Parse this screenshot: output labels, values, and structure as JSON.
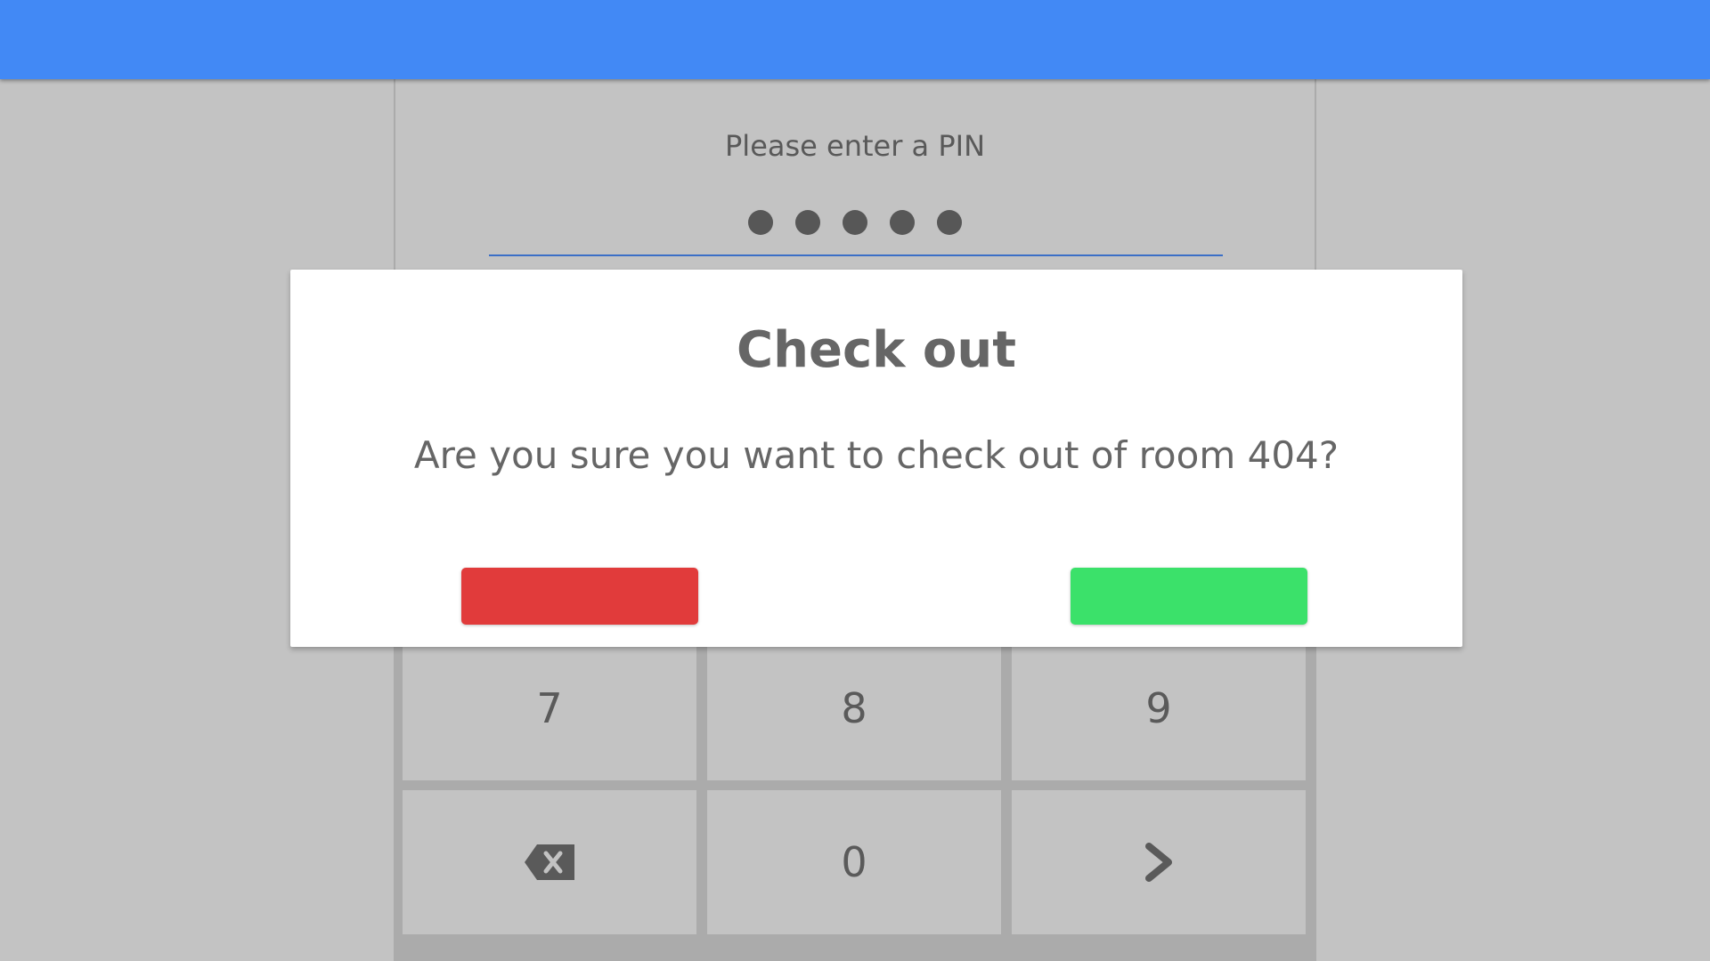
{
  "pin_screen": {
    "prompt": "Please enter a PIN",
    "entered_digits_count": 5
  },
  "keypad": {
    "keys": [
      "7",
      "8",
      "9",
      "backspace-icon",
      "0",
      "chevron-right-icon"
    ],
    "labels": {
      "seven": "7",
      "eight": "8",
      "nine": "9",
      "zero": "0"
    }
  },
  "dialog": {
    "title": "Check out",
    "message": "Are you sure you want to check out of room 404?",
    "cancel_color": "#e13b3b",
    "confirm_color": "#3be16a"
  },
  "colors": {
    "accent": "#4289f5",
    "background": "#c3c3c3"
  }
}
